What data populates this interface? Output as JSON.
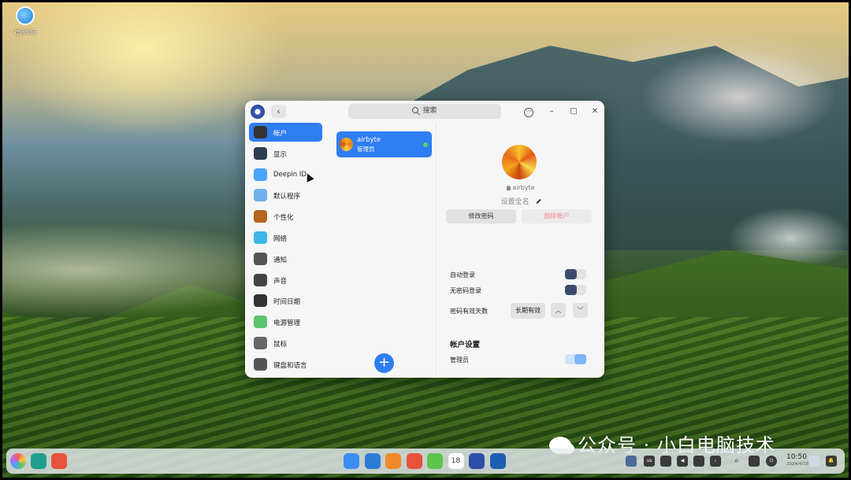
{
  "desktop": {
    "icon_label": "社区论坛"
  },
  "window": {
    "search_placeholder": "搜索",
    "sidebar": {
      "items": [
        {
          "label": "帐户",
          "icon": "account-icon",
          "active": true,
          "color": "#333333"
        },
        {
          "label": "显示",
          "icon": "display-icon",
          "active": false,
          "color": "#2c3e50"
        },
        {
          "label": "Deepin ID",
          "icon": "cloud-icon",
          "active": false,
          "color": "#4aa3ff"
        },
        {
          "label": "默认程序",
          "icon": "default-apps-icon",
          "active": false,
          "color": "#6fb0f0"
        },
        {
          "label": "个性化",
          "icon": "palette-icon",
          "active": false,
          "color": "#b5651d"
        },
        {
          "label": "网络",
          "icon": "globe-icon",
          "active": false,
          "color": "#3fb6e8"
        },
        {
          "label": "通知",
          "icon": "bell-icon",
          "active": false,
          "color": "#555555"
        },
        {
          "label": "声音",
          "icon": "speaker-icon",
          "active": false,
          "color": "#444444"
        },
        {
          "label": "时间日期",
          "icon": "clock-icon",
          "active": false,
          "color": "#333333"
        },
        {
          "label": "电源管理",
          "icon": "battery-icon",
          "active": false,
          "color": "#5cc36a"
        },
        {
          "label": "鼠标",
          "icon": "mouse-icon",
          "active": false,
          "color": "#666666"
        },
        {
          "label": "键盘和语言",
          "icon": "keyboard-icon",
          "active": false,
          "color": "#555555"
        }
      ]
    },
    "account_list": {
      "accounts": [
        {
          "name": "airbyte",
          "role": "管理员",
          "online": true
        }
      ],
      "add_label": "+"
    },
    "detail": {
      "username": "airbyte",
      "fullname_placeholder": "设置全名",
      "change_password_label": "修改密码",
      "delete_account_label": "删除帐户",
      "auto_login_label": "自动登录",
      "auto_login_on": false,
      "no_password_login_label": "无密码登录",
      "no_password_login_on": false,
      "password_validity_label": "密码有效天数",
      "password_validity_value": "长期有效",
      "section_title": "帐户设置",
      "admin_label": "管理员",
      "admin_on": true
    }
  },
  "taskbar": {
    "left_icons": [
      "launcher-icon",
      "terminal-icon",
      "multitask-icon"
    ],
    "dock_icons": [
      {
        "name": "app-store-icon",
        "color": "#3d8df5"
      },
      {
        "name": "browser-icon",
        "color": "#2b7bd6"
      },
      {
        "name": "file-manager-icon",
        "color": "#f08a2a"
      },
      {
        "name": "image-viewer-icon",
        "color": "#e8523a"
      },
      {
        "name": "music-icon",
        "color": "#5cc44a"
      },
      {
        "name": "calendar-icon",
        "color": "#ffffff",
        "text": "18"
      },
      {
        "name": "control-center-icon",
        "color": "#2d4fa8"
      },
      {
        "name": "deepin-icon",
        "color": "#1d5fb0"
      }
    ],
    "tray": {
      "keyboard_layout": "us",
      "time": "10:50",
      "date": "2024/4/18"
    }
  },
  "watermark": "公众号 · 小白电脑技术"
}
